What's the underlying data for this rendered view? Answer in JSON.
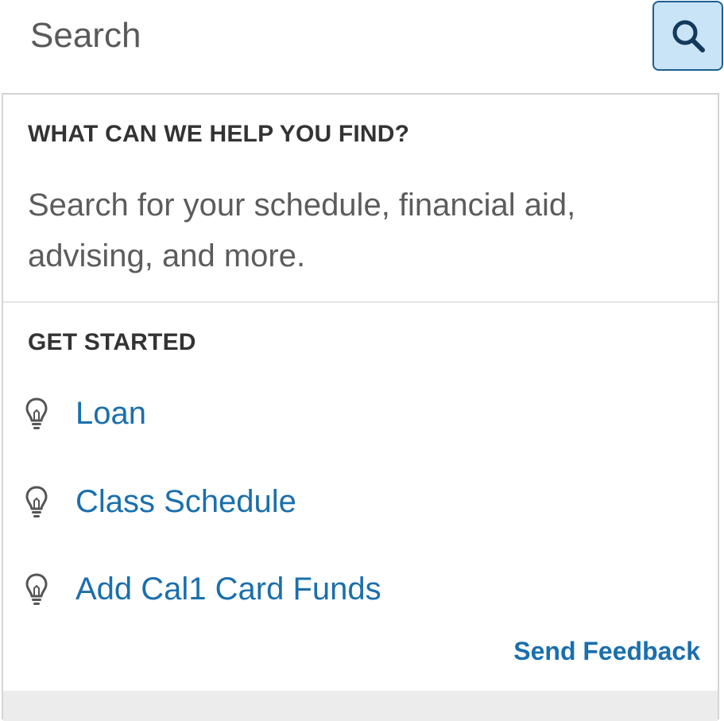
{
  "search": {
    "placeholder": "Search",
    "button_icon": "search-icon",
    "button_bg": "#c9e3f7",
    "button_border": "#1d5f91"
  },
  "help": {
    "heading": "WHAT CAN WE HELP YOU FIND?",
    "description": "Search for your schedule, financial aid, advising, and more."
  },
  "get_started": {
    "heading": "GET STARTED",
    "items": [
      {
        "icon": "lightbulb-icon",
        "label": "Loan"
      },
      {
        "icon": "lightbulb-icon",
        "label": "Class Schedule"
      },
      {
        "icon": "lightbulb-icon",
        "label": "Add Cal1 Card Funds"
      }
    ]
  },
  "feedback": {
    "label": "Send Feedback"
  },
  "colors": {
    "link": "#1a6fad",
    "heading": "#333333",
    "body_text": "#5c5c5c"
  }
}
